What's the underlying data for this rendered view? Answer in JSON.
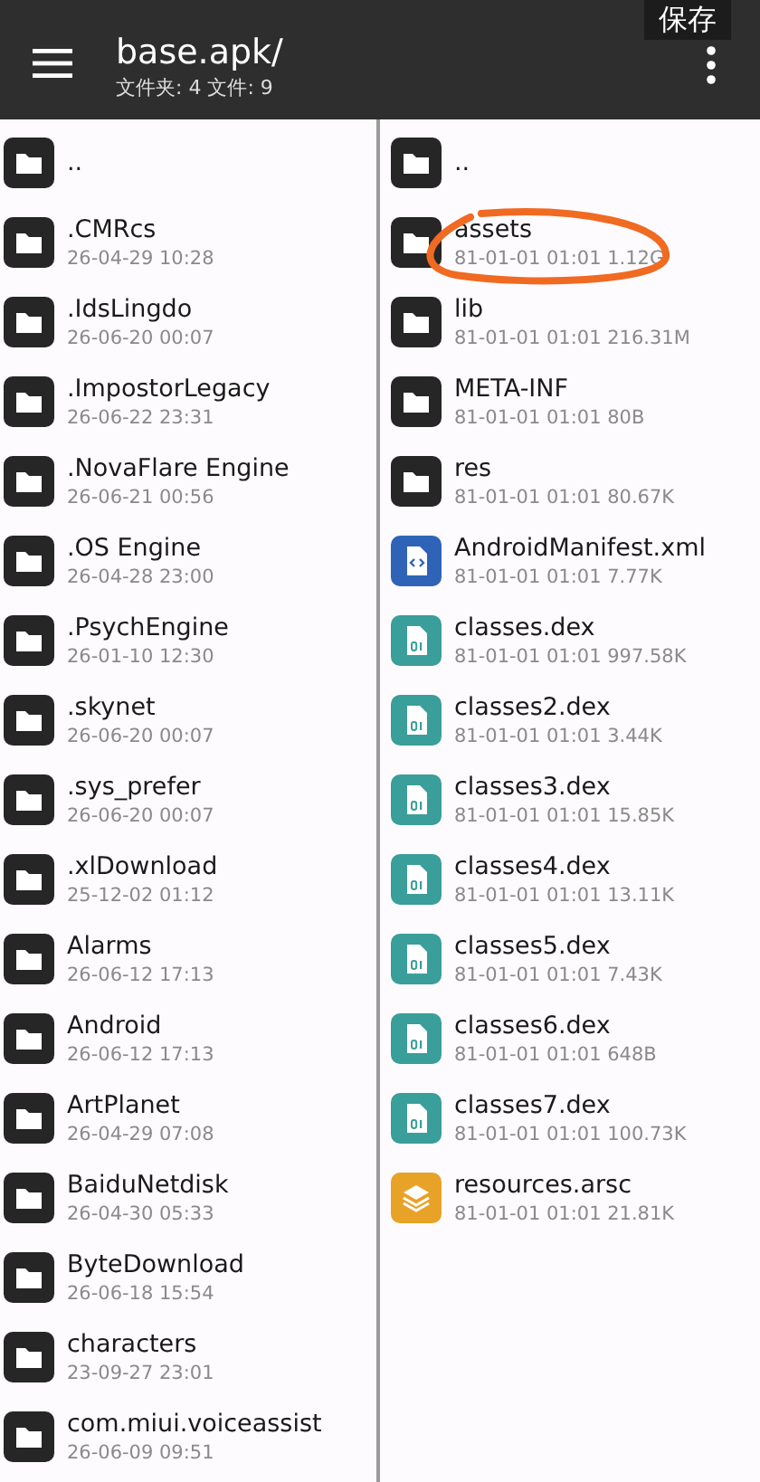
{
  "header": {
    "title": "base.apk/",
    "subtitle": "文件夹: 4  文件: 9",
    "tooltip": "保存"
  },
  "left_pane": [
    {
      "kind": "folder",
      "name": ".."
    },
    {
      "kind": "folder",
      "name": ".CMRcs",
      "info": "26-04-29 10:28"
    },
    {
      "kind": "folder",
      "name": ".IdsLingdo",
      "info": "26-06-20 00:07"
    },
    {
      "kind": "folder",
      "name": ".ImpostorLegacy",
      "info": "26-06-22 23:31"
    },
    {
      "kind": "folder",
      "name": ".NovaFlare Engine",
      "info": "26-06-21 00:56"
    },
    {
      "kind": "folder",
      "name": ".OS Engine",
      "info": "26-04-28 23:00"
    },
    {
      "kind": "folder",
      "name": ".PsychEngine",
      "info": "26-01-10 12:30"
    },
    {
      "kind": "folder",
      "name": ".skynet",
      "info": "26-06-20 00:07"
    },
    {
      "kind": "folder",
      "name": ".sys_prefer",
      "info": "26-06-20 00:07"
    },
    {
      "kind": "folder",
      "name": ".xlDownload",
      "info": "25-12-02 01:12"
    },
    {
      "kind": "folder",
      "name": "Alarms",
      "info": "26-06-12 17:13"
    },
    {
      "kind": "folder",
      "name": "Android",
      "info": "26-06-12 17:13"
    },
    {
      "kind": "folder",
      "name": "ArtPlanet",
      "info": "26-04-29 07:08"
    },
    {
      "kind": "folder",
      "name": "BaiduNetdisk",
      "info": "26-04-30 05:33"
    },
    {
      "kind": "folder",
      "name": "ByteDownload",
      "info": "26-06-18 15:54"
    },
    {
      "kind": "folder",
      "name": "characters",
      "info": "23-09-27 23:01"
    },
    {
      "kind": "folder",
      "name": "com.miui.voiceassist",
      "info": "26-06-09 09:51"
    }
  ],
  "right_pane": [
    {
      "kind": "folder",
      "name": ".."
    },
    {
      "kind": "folder",
      "name": "assets",
      "info": "81-01-01 01:01  1.12G",
      "circled": true
    },
    {
      "kind": "folder",
      "name": "lib",
      "info": "81-01-01 01:01  216.31M"
    },
    {
      "kind": "folder",
      "name": "META-INF",
      "info": "81-01-01 01:01  80B"
    },
    {
      "kind": "folder",
      "name": "res",
      "info": "81-01-01 01:01  80.67K"
    },
    {
      "kind": "xml",
      "name": "AndroidManifest.xml",
      "info": "81-01-01 01:01  7.77K"
    },
    {
      "kind": "dex",
      "name": "classes.dex",
      "info": "81-01-01 01:01  997.58K"
    },
    {
      "kind": "dex",
      "name": "classes2.dex",
      "info": "81-01-01 01:01  3.44K"
    },
    {
      "kind": "dex",
      "name": "classes3.dex",
      "info": "81-01-01 01:01  15.85K"
    },
    {
      "kind": "dex",
      "name": "classes4.dex",
      "info": "81-01-01 01:01  13.11K"
    },
    {
      "kind": "dex",
      "name": "classes5.dex",
      "info": "81-01-01 01:01  7.43K"
    },
    {
      "kind": "dex",
      "name": "classes6.dex",
      "info": "81-01-01 01:01  648B"
    },
    {
      "kind": "dex",
      "name": "classes7.dex",
      "info": "81-01-01 01:01  100.73K"
    },
    {
      "kind": "arsc",
      "name": "resources.arsc",
      "info": "81-01-01 01:01  21.81K"
    }
  ]
}
